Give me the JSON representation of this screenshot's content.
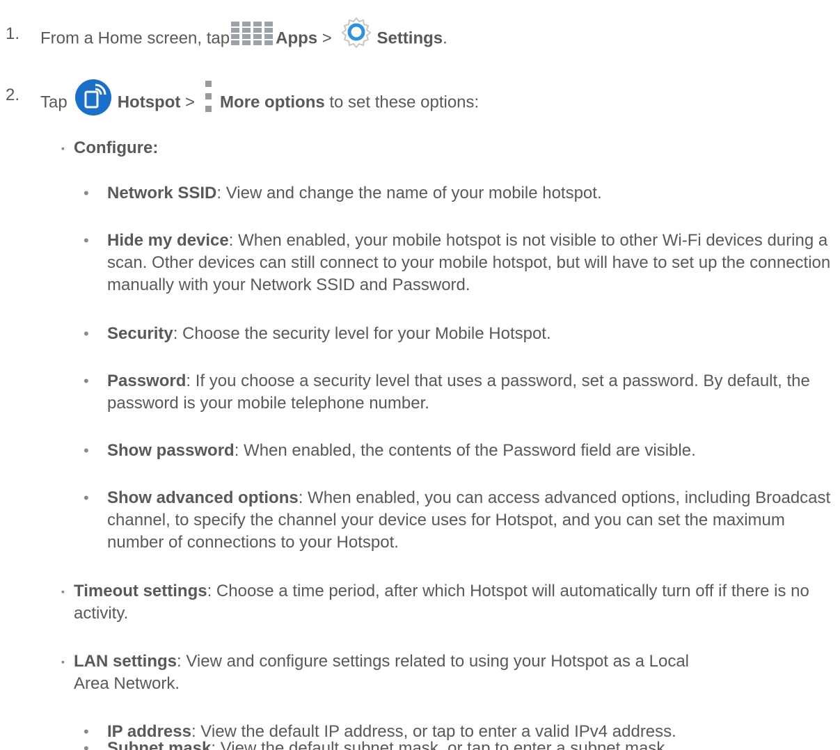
{
  "steps": [
    {
      "number": "1.",
      "text_before": "From a Home screen, tap",
      "apps_label": "Apps",
      "sep": ">",
      "settings_label": "Settings",
      "end": "."
    },
    {
      "number": "2.",
      "text_before": "Tap",
      "hotspot_label": "Hotspot",
      "sep": ">",
      "more_label": "More options",
      "text_after": "to set these options:"
    }
  ],
  "configure": {
    "bullet": "▪",
    "label": "Configure:"
  },
  "configure_items": [
    {
      "term": "Network SSID",
      "desc": ": View and change the name of your mobile hotspot."
    },
    {
      "term": "Hide my device",
      "desc": ": When enabled, your mobile hotspot is not visible to other Wi-Fi devices during a scan. Other devices can still connect to your mobile hotspot, but will have to set up the connection manually with your Network SSID and Password."
    },
    {
      "term": "Security",
      "desc": ": Choose the security level for your Mobile Hotspot."
    },
    {
      "term": "Password",
      "desc": ": If you choose a security level that uses a password, set a password. By default, the password is your mobile telephone number."
    },
    {
      "term": "Show password",
      "desc": ": When enabled, the contents of the Password field are visible."
    },
    {
      "term": "Show advanced options",
      "desc": ": When enabled, you can access advanced options, including Broadcast channel, to specify the channel your device uses for Hotspot, and you can set the maximum number of connections to your Hotspot."
    }
  ],
  "timeout": {
    "bullet": "▪",
    "term": "Timeout settings",
    "desc": ": Choose a time period, after which Hotspot will automatically turn off if there is no activity."
  },
  "lan": {
    "bullet": "▪",
    "term": "LAN settings",
    "desc": ": View and configure settings related to using your Hotspot as a Local Area Network."
  },
  "lan_items": [
    {
      "term": "IP address",
      "desc": ": View the default IP address, or tap to enter a valid IPv4 address."
    },
    {
      "term": "Subnet mask",
      "desc": ": View the default subnet mask, or tap to enter a subnet mask."
    }
  ],
  "dot_bullet": "•",
  "colors": {
    "text": "#595959",
    "hotspot_blue": "#1a6fc9",
    "gear_blue": "#2f8fe0",
    "icon_gray": "#9aa1a8"
  },
  "icons": [
    "apps-icon",
    "settings-gear-icon",
    "hotspot-icon",
    "more-options-icon"
  ]
}
